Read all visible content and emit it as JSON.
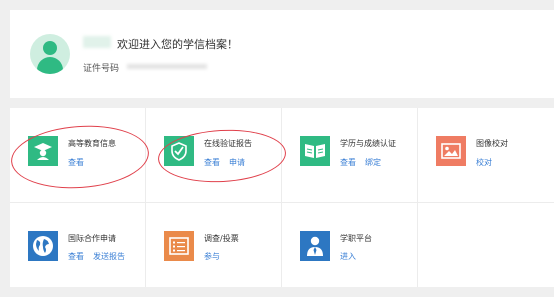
{
  "welcome": {
    "greeting": "欢迎进入您的学信档案！",
    "id_label": "证件号码"
  },
  "colors": {
    "green": "#2fba83",
    "blue": "#2d77c2",
    "salmon": "#ef7c63",
    "orange": "#ea8a4a",
    "link": "#3a7fd5",
    "annotation": "#e0404b"
  },
  "services": [
    {
      "title": "高等教育信息",
      "icon": "graduate-icon",
      "links": [
        "查看"
      ]
    },
    {
      "title": "在线验证报告",
      "icon": "shield-check-icon",
      "links": [
        "查看",
        "申请"
      ]
    },
    {
      "title": "学历与成绩认证",
      "icon": "book-icon",
      "links": [
        "查看",
        "绑定"
      ]
    },
    {
      "title": "图像校对",
      "icon": "image-icon",
      "links": [
        "校对"
      ]
    },
    {
      "title": "国际合作申请",
      "icon": "globe-icon",
      "links": [
        "查看",
        "发送报告"
      ]
    },
    {
      "title": "调查/投票",
      "icon": "list-icon",
      "links": [
        "参与"
      ]
    },
    {
      "title": "学职平台",
      "icon": "person-tie-icon",
      "links": [
        "进入"
      ]
    }
  ]
}
